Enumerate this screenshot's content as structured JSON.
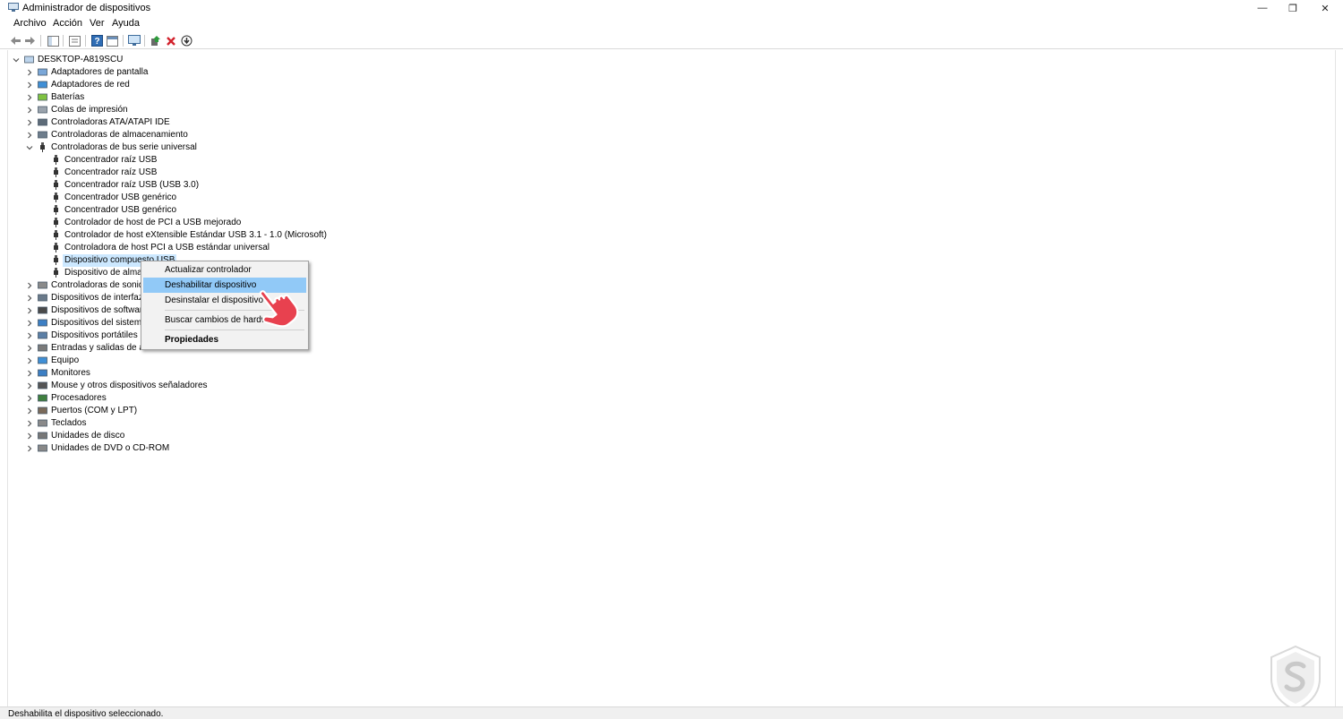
{
  "window": {
    "title": "Administrador de dispositivos",
    "controls": {
      "minimize": "—",
      "restore": "❐",
      "close": "✕"
    }
  },
  "menubar": {
    "items": [
      "Archivo",
      "Acción",
      "Ver",
      "Ayuda"
    ]
  },
  "toolbar": {
    "buttons": [
      "back-icon",
      "forward-icon",
      "show-hide-tree-icon",
      "properties-icon",
      "help-icon",
      "console-icon",
      "scan-hardware-icon",
      "update-driver-icon",
      "uninstall-icon",
      "disable-icon"
    ]
  },
  "tree": {
    "root": "DESKTOP-A819SCU",
    "categories": [
      "Adaptadores de pantalla",
      "Adaptadores de red",
      "Baterías",
      "Colas de impresión",
      "Controladoras ATA/ATAPI IDE",
      "Controladoras de almacenamiento",
      "Controladoras de bus serie universal"
    ],
    "usb_children": [
      "Concentrador raíz USB",
      "Concentrador raíz USB",
      "Concentrador raíz USB (USB 3.0)",
      "Concentrador USB genérico",
      "Concentrador USB genérico",
      "Controlador de host de PCI a USB mejorado",
      "Controlador de host eXtensible Estándar USB 3.1 - 1.0 (Microsoft)",
      "Controladora de host PCI a USB estándar universal",
      "Dispositivo compuesto USB",
      "Dispositivo de almac"
    ],
    "categories_after": [
      "Controladoras de sonido",
      "Dispositivos de interfaz d",
      "Dispositivos de software",
      "Dispositivos del sistema",
      "Dispositivos portátiles",
      "Entradas y salidas de aud",
      "Equipo",
      "Monitores",
      "Mouse y otros dispositivos señaladores",
      "Procesadores",
      "Puertos (COM y LPT)",
      "Teclados",
      "Unidades de disco",
      "Unidades de DVD o CD-ROM"
    ]
  },
  "context_menu": {
    "items": [
      "Actualizar controlador",
      "Deshabilitar dispositivo",
      "Desinstalar el dispositivo",
      "Buscar cambios de hardware",
      "Propiedades"
    ],
    "highlighted": "Deshabilitar dispositivo"
  },
  "statusbar": {
    "text": "Deshabilita el dispositivo seleccionado."
  },
  "colors": {
    "selection": "#cce8ff",
    "menu_hover": "#91c9f7",
    "pointer": "#e8414f"
  }
}
